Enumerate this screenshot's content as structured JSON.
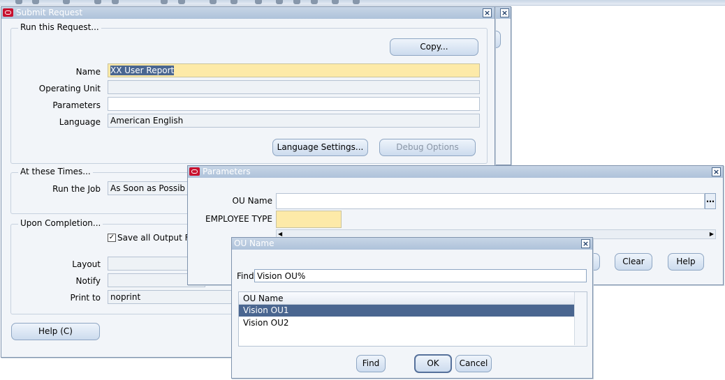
{
  "submit_request": {
    "title": "Submit Request",
    "run_section": "Run this Request...",
    "copy_label": "Copy...",
    "name_label": "Name",
    "name_value": "XX User Report",
    "operating_unit_label": "Operating Unit",
    "operating_unit_value": "",
    "parameters_label": "Parameters",
    "parameters_value": "",
    "language_label": "Language",
    "language_value": "American English",
    "language_settings_label": "Language Settings...",
    "debug_options_label": "Debug Options",
    "times_section": "At these Times...",
    "run_job_label": "Run the Job",
    "run_job_value": "As Soon as Possib",
    "completion_section": "Upon Completion...",
    "save_output_label": "Save all Output F",
    "layout_label": "Layout",
    "notify_label": "Notify",
    "print_to_label": "Print to",
    "print_to_value": "noprint",
    "help_label": "Help (C)"
  },
  "parameters": {
    "title": "Parameters",
    "ou_name_label": "OU Name",
    "ou_name_value": "",
    "employee_type_label": "EMPLOYEE TYPE",
    "employee_type_value": "",
    "clear_label": "Clear",
    "help_label": "Help"
  },
  "ou_lov": {
    "title": "OU Name",
    "find_label": "Find",
    "find_value": "Vision OU%",
    "column_header": "OU Name",
    "rows": [
      "Vision OU1",
      "Vision OU2"
    ],
    "find_button": "Find",
    "ok_button": "OK",
    "cancel_button": "Cancel"
  }
}
